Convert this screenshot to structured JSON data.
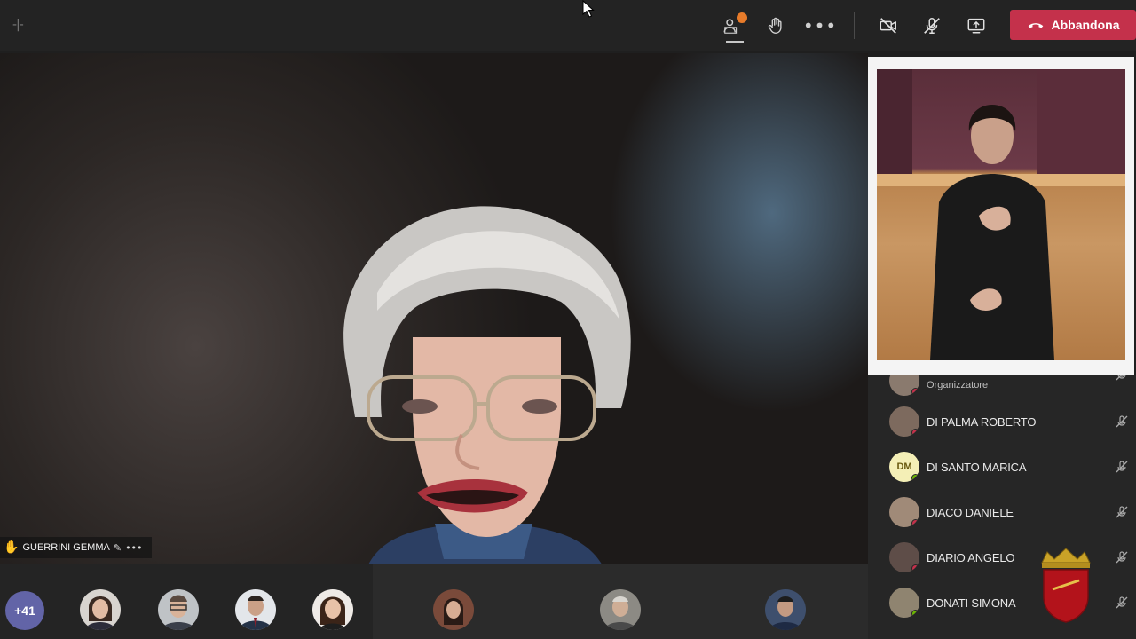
{
  "toolbar": {
    "leave_label": "Abbandona",
    "leave_color": "#c4314b",
    "grip": "-|-",
    "more": "•••",
    "icons": [
      "participants-icon",
      "raise-hand-icon",
      "more-options-icon",
      "camera-off-icon",
      "mic-off-icon",
      "share-screen-icon",
      "phone-hangup-icon"
    ]
  },
  "speaker": {
    "name": "GUERRINI GEMMA"
  },
  "participants": [
    {
      "name": "",
      "role": "Organizzatore",
      "avatar": "photo"
    },
    {
      "name": "DI PALMA ROBERTO",
      "avatar": "photo"
    },
    {
      "name": "DI SANTO MARICA",
      "avatar": "initials",
      "initials": "DM"
    },
    {
      "name": "DIACO DANIELE",
      "avatar": "photo"
    },
    {
      "name": "DIARIO ANGELO",
      "avatar": "photo"
    },
    {
      "name": "DONATI SIMONA",
      "avatar": "photo"
    }
  ],
  "strip": {
    "more_count": "+41"
  }
}
